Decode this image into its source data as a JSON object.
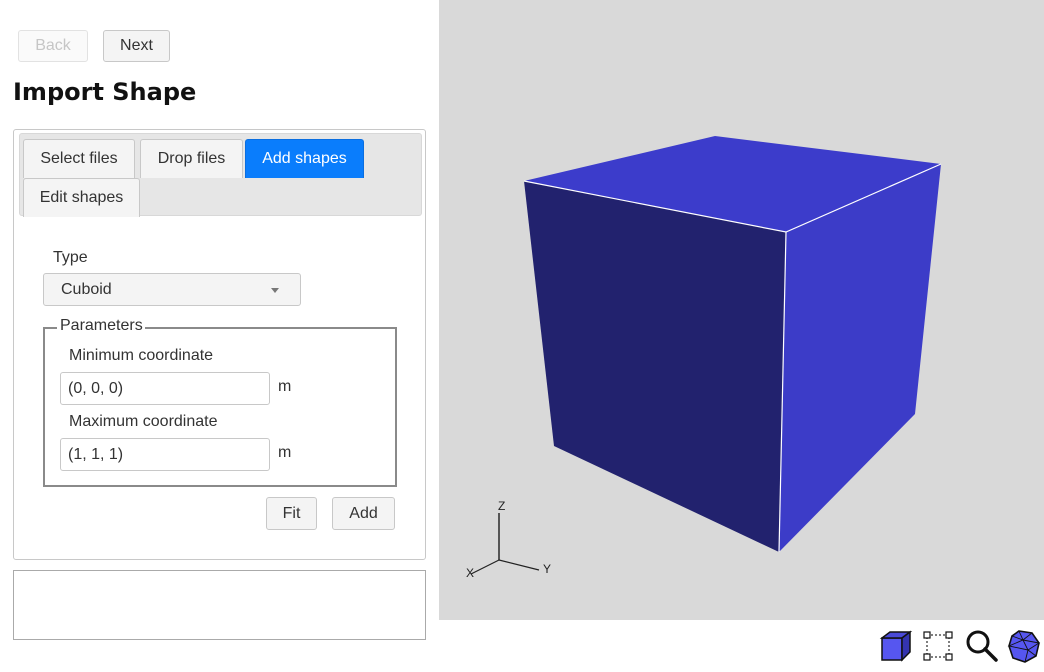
{
  "nav": {
    "back_label": "Back",
    "next_label": "Next",
    "back_disabled": true
  },
  "page_title": "Import Shape",
  "tabs": [
    {
      "label": "Select files",
      "active": false
    },
    {
      "label": "Drop files",
      "active": false
    },
    {
      "label": "Add shapes",
      "active": true
    },
    {
      "label": "Edit shapes",
      "active": false
    }
  ],
  "form": {
    "type_label": "Type",
    "type_value": "Cuboid",
    "parameters_legend": "Parameters",
    "min_label": "Minimum coordinate",
    "min_value": "(0, 0, 0)",
    "min_unit": "m",
    "max_label": "Maximum coordinate",
    "max_value": "(1, 1, 1)",
    "max_unit": "m",
    "fit_label": "Fit",
    "add_label": "Add"
  },
  "log_text": "",
  "viewport": {
    "axes": {
      "x": "X",
      "y": "Y",
      "z": "Z"
    },
    "colors": {
      "background": "#d9d9d9",
      "face_top": "#3c3ccb",
      "face_left": "#22226e",
      "face_right": "#3c3cc8",
      "edge": "#ffffff"
    }
  },
  "toolbar": [
    {
      "icon": "solid-view-icon",
      "title": "Solid view"
    },
    {
      "icon": "box-select-icon",
      "title": "Box select"
    },
    {
      "icon": "zoom-icon",
      "title": "Zoom"
    },
    {
      "icon": "mesh-view-icon",
      "title": "Mesh view"
    }
  ]
}
